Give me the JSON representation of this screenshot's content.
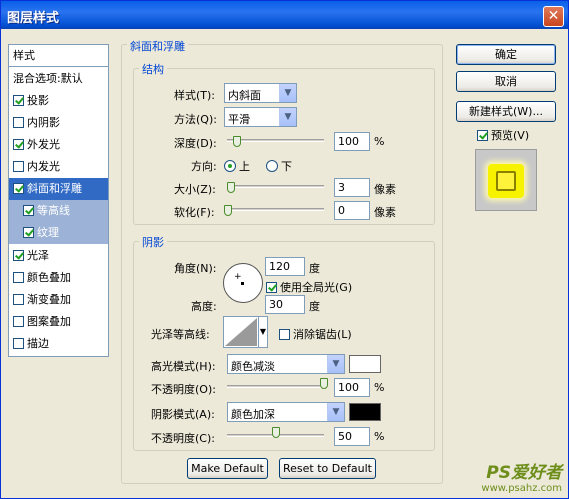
{
  "window": {
    "title": "图层样式"
  },
  "styles_list": {
    "header": "样式",
    "blend_options": "混合选项:默认",
    "items": [
      {
        "label": "投影",
        "checked": true
      },
      {
        "label": "内阴影",
        "checked": false
      },
      {
        "label": "外发光",
        "checked": true
      },
      {
        "label": "内发光",
        "checked": false
      },
      {
        "label": "斜面和浮雕",
        "checked": true,
        "selected": true
      },
      {
        "label": "等高线",
        "checked": true,
        "sub": true
      },
      {
        "label": "纹理",
        "checked": true,
        "sub": true
      },
      {
        "label": "光泽",
        "checked": true
      },
      {
        "label": "颜色叠加",
        "checked": false
      },
      {
        "label": "渐变叠加",
        "checked": false
      },
      {
        "label": "图案叠加",
        "checked": false
      },
      {
        "label": "描边",
        "checked": false
      }
    ]
  },
  "bevel": {
    "group_title": "斜面和浮雕",
    "structure": {
      "title": "结构",
      "style_label": "样式(T):",
      "style_value": "内斜面",
      "technique_label": "方法(Q):",
      "technique_value": "平滑",
      "depth_label": "深度(D):",
      "depth_value": "100",
      "depth_fraction": 0.1,
      "depth_unit": "%",
      "direction_label": "方向:",
      "direction_up": "上",
      "direction_down": "下",
      "size_label": "大小(Z):",
      "size_value": "3",
      "size_unit": "像素",
      "soften_label": "软化(F):",
      "soften_value": "0",
      "soften_unit": "像素"
    },
    "shading": {
      "title": "阴影",
      "angle_label": "角度(N):",
      "angle_value": "120",
      "angle_unit": "度",
      "global_light_label": "使用全局光(G)",
      "global_light_checked": true,
      "altitude_label": "高度:",
      "altitude_value": "30",
      "altitude_unit": "度",
      "gloss_contour_label": "光泽等高线:",
      "anti_aliased_label": "消除锯齿(L)",
      "highlight_mode_label": "高光模式(H):",
      "highlight_mode_value": "颜色减淡",
      "highlight_color": "#ffffff",
      "highlight_opacity_label": "不透明度(O):",
      "highlight_opacity_value": "100",
      "highlight_opacity_unit": "%",
      "shadow_mode_label": "阴影模式(A):",
      "shadow_mode_value": "颜色加深",
      "shadow_color": "#000000",
      "shadow_opacity_label": "不透明度(C):",
      "shadow_opacity_value": "50",
      "shadow_opacity_unit": "%"
    },
    "make_default": "Make Default",
    "reset_default": "Reset to Default"
  },
  "buttons": {
    "ok": "确定",
    "cancel": "取消",
    "new_style": "新建样式(W)...",
    "preview": "预览(V)"
  },
  "watermark": {
    "brand": "PS爱好者",
    "url": "www.psahz.com"
  }
}
